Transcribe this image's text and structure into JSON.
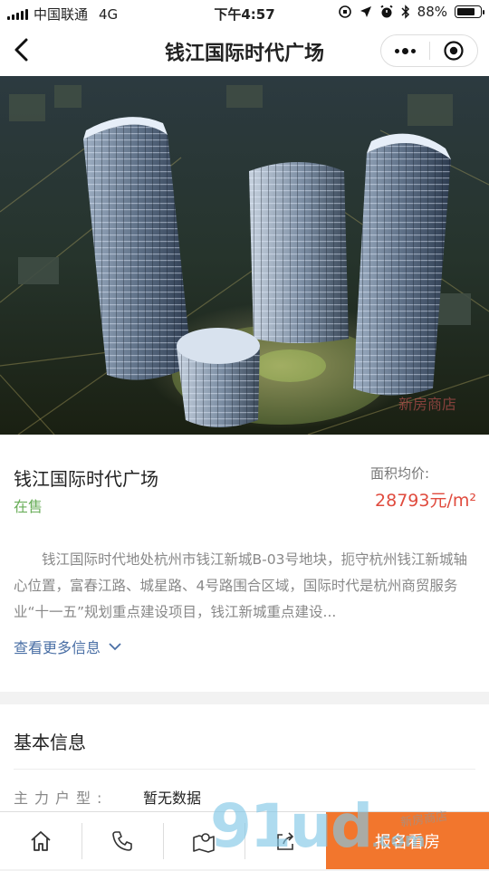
{
  "status_bar": {
    "carrier": "中国联通",
    "network": "4G",
    "time": "下午4:57",
    "battery": "88%",
    "battery_level": 0.88
  },
  "nav": {
    "title": "钱江国际时代广场",
    "back_icon": "chevron-left-icon",
    "more_icon": "more-dots-icon",
    "close_icon": "target-circle-icon"
  },
  "hero": {
    "watermark": "新房商店"
  },
  "project": {
    "name": "钱江国际时代广场",
    "status": "在售",
    "price_label": "面积均价:",
    "price_value": "28793元/m²",
    "description": "钱江国际时代地处杭州市钱江新城B-03号地块，扼守杭州钱江新城轴心位置，富春江路、城星路、4号路围合区域，国际时代是杭州商贸服务业“十一五”规划重点建设项目，钱江新城重点建设...",
    "more_label": "查看更多信息"
  },
  "basic_info": {
    "title": "基本信息",
    "rows": [
      {
        "label": "主力户型:",
        "value": "暂无数据"
      }
    ]
  },
  "tabbar": {
    "home_icon": "home-icon",
    "phone_icon": "phone-icon",
    "map_icon": "map-pin-icon",
    "share_icon": "share-icon",
    "cta_label": "报名看房"
  },
  "watermark": {
    "logo": "91ud",
    "sub": "新房商店",
    "domain": ".com"
  },
  "colors": {
    "accent": "#f2762d",
    "price": "#e04b3e",
    "status_green": "#6aae5a",
    "link": "#4a6fa5"
  }
}
